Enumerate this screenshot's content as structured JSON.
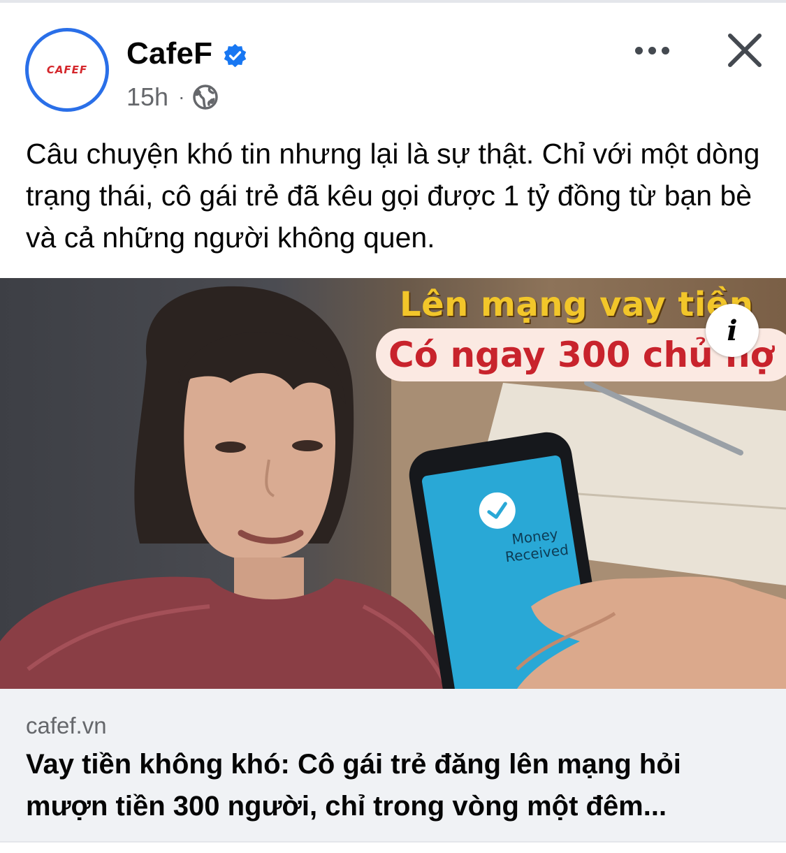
{
  "post": {
    "page_name": "CafeF",
    "avatar_logo_text": "CAFEF",
    "time": "15h",
    "separator": "·",
    "privacy_icon": "globe-icon",
    "verified_icon": "verified-badge-icon",
    "more_icon": "more-options-icon",
    "close_icon": "close-icon",
    "text": "Câu chuyện khó tin nhưng lại là sự thật. Chỉ với một dòng trạng thái, cô gái trẻ đã kêu gọi được 1 tỷ đồng từ bạn bè và cả những người không quen."
  },
  "media": {
    "overlay_line1": "Lên mạng vay tiền",
    "overlay_line2": "Có ngay 300 chủ nợ",
    "phone_screen_line1": "Money",
    "phone_screen_line2": "Received",
    "info_label": "i"
  },
  "link": {
    "domain": "cafef.vn",
    "title": "Vay tiền không khó: Cô gái trẻ đăng lên mạng hỏi mượn tiền 300 người, chỉ trong vòng một đêm..."
  },
  "colors": {
    "avatar_ring": "#2a6fe8",
    "verified": "#1877f2",
    "overlay_yellow": "#f2c62a",
    "overlay_red": "#c8232c",
    "phone_screen": "#29a8d6"
  }
}
